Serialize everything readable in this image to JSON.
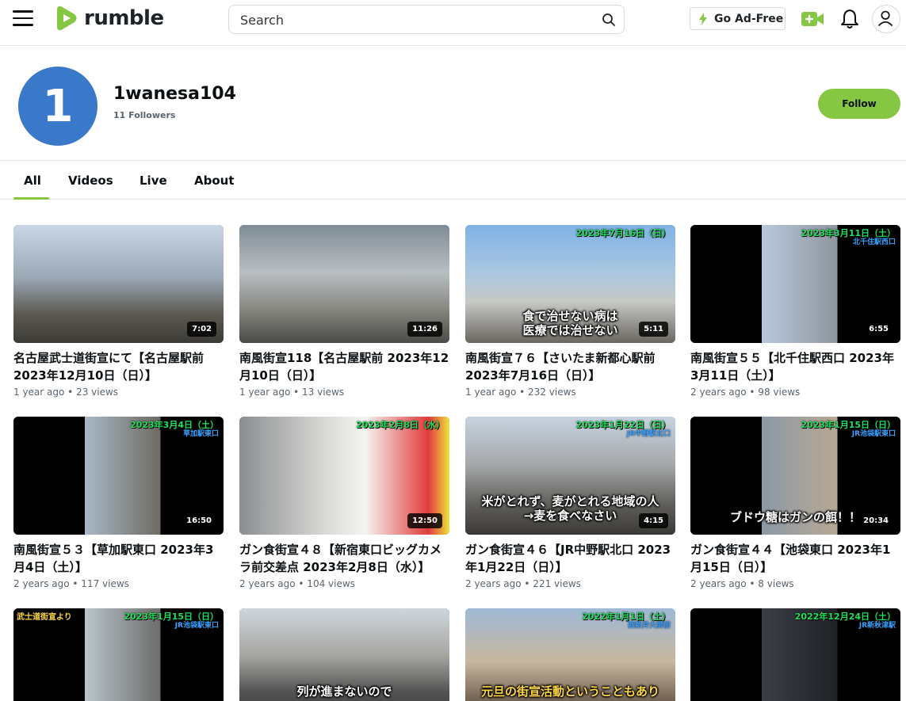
{
  "header": {
    "logo_text": "rumble",
    "search_placeholder": "Search",
    "adfree_label": "Go Ad-Free"
  },
  "channel": {
    "avatar_initial": "1",
    "name": "1wanesa104",
    "followers": "11 Followers",
    "follow_label": "Follow"
  },
  "tabs": [
    "All",
    "Videos",
    "Live",
    "About"
  ],
  "videos": [
    {
      "title": "名古屋武士道街宣にて【名古屋駅前 2023年12月10日（日）】",
      "age": "1 year ago",
      "views": "23",
      "duration": "7:02"
    },
    {
      "title": "南風街宣118【名古屋駅前 2023年12月10日（日）】",
      "age": "1 year ago",
      "views": "13",
      "duration": "11:26"
    },
    {
      "title": "南風街宣７６【さいたま新都心駅前 2023年7月16日（日）】",
      "age": "1 year ago",
      "views": "232",
      "duration": "5:11",
      "caption": "食で治せない病は\n医療では治せない",
      "ov_date": "2023年7月16日（日）"
    },
    {
      "title": "南風街宣５５【北千住駅西口 2023年3月11日（土）】",
      "age": "2 years ago",
      "views": "98",
      "duration": "6:55",
      "ov_date": "2023年3月11日（土）",
      "ov_place": "北千住駅西口"
    },
    {
      "title": "南風街宣５３【草加駅東口 2023年3月4日（土）】",
      "age": "2 years ago",
      "views": "117",
      "duration": "16:50",
      "ov_date": "2023年3月4日（土）",
      "ov_place": "草加駅東口"
    },
    {
      "title": "ガン食街宣４８【新宿東口ビッグカメラ前交差点 2023年2月8日（水）】",
      "age": "2 years ago",
      "views": "104",
      "duration": "12:50",
      "ov_date": "2023年2月8日（水）"
    },
    {
      "title": "ガン食街宣４６【JR中野駅北口 2023年1月22日（日）】",
      "age": "2 years ago",
      "views": "221",
      "duration": "4:15",
      "caption": "米がとれず、麦がとれる地域の人\n→麦を食べなさい",
      "ov_date": "2023年1月22日（日）",
      "ov_place": "JR中野駅北口"
    },
    {
      "title": "ガン食街宣４４【池袋東口 2023年1月15日（日）】",
      "age": "2 years ago",
      "views": "8",
      "duration": "20:34",
      "caption": "ブドウ糖はガンの餌！！",
      "ov_date": "2023年1月15日（日）",
      "ov_place": "JR池袋駅東口"
    },
    {
      "title": "",
      "age": "",
      "views": "",
      "duration": "",
      "ov_date": "2023年1月15日（日）",
      "ov_place": "JR池袋駅東口",
      "ov_tl": "武士道街宣より"
    },
    {
      "title": "",
      "age": "",
      "views": "",
      "duration": "",
      "caption": "列が進まないので"
    },
    {
      "title": "",
      "age": "",
      "views": "",
      "duration": "",
      "caption": "元旦の街宣活動ということもあり",
      "ov_date": "2022年1月1日（土）",
      "ov_place": "西新井大師前"
    },
    {
      "title": "",
      "age": "",
      "views": "",
      "duration": "",
      "ov_date": "2022年12月24日（土）",
      "ov_place": "JR新秋津駅"
    }
  ],
  "views_suffix": "views",
  "colors": {
    "accent": "#85c742",
    "avatar": "#3a78c9"
  }
}
